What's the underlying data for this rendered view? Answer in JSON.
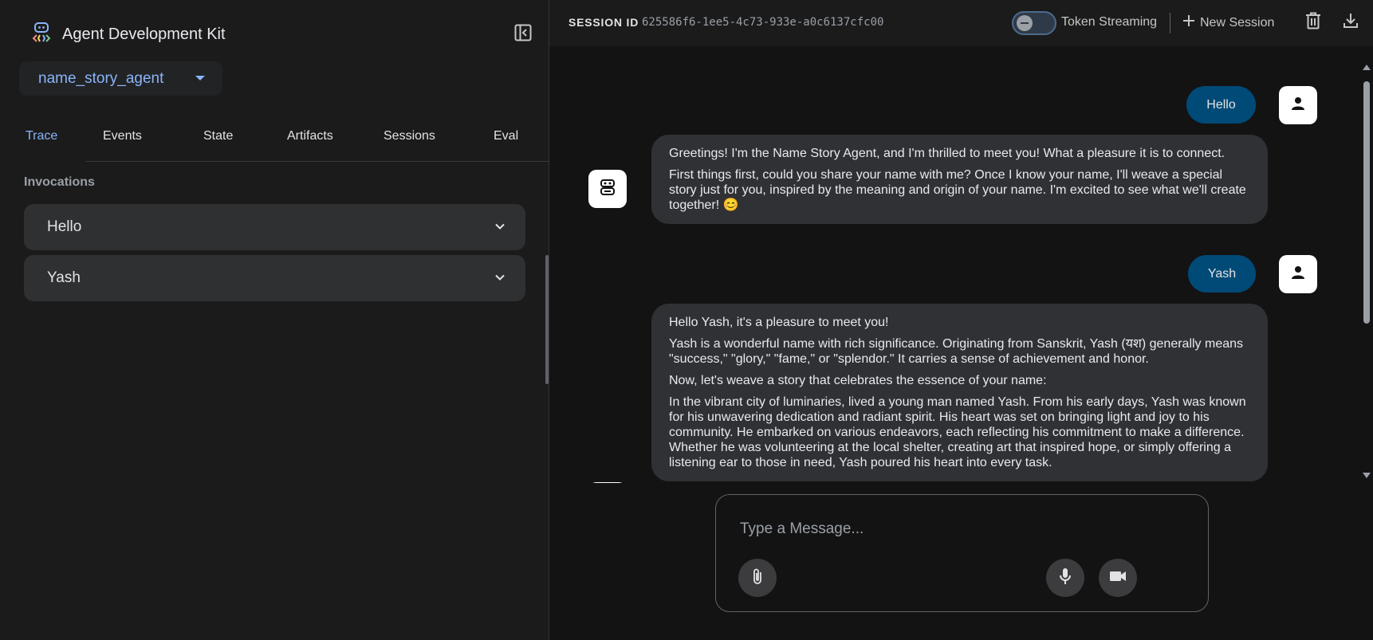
{
  "sidebar": {
    "brand_title": "Agent Development Kit",
    "agent_selector": {
      "selected": "name_story_agent"
    },
    "tabs": [
      {
        "label": "Trace",
        "active": true
      },
      {
        "label": "Events",
        "active": false
      },
      {
        "label": "State",
        "active": false
      },
      {
        "label": "Artifacts",
        "active": false
      },
      {
        "label": "Sessions",
        "active": false
      },
      {
        "label": "Eval",
        "active": false
      }
    ],
    "invocations_heading": "Invocations",
    "invocations": [
      {
        "label": "Hello"
      },
      {
        "label": "Yash"
      }
    ]
  },
  "topbar": {
    "session_label": "SESSION ID",
    "session_id": "625586f6-1ee5-4c73-933e-a0c6137cfc00",
    "token_streaming_label": "Token Streaming",
    "token_streaming_enabled": false,
    "new_session_label": "New Session"
  },
  "chat": {
    "messages": [
      {
        "role": "user",
        "text": "Hello"
      },
      {
        "role": "agent",
        "paragraphs": [
          "Greetings! I'm the Name Story Agent, and I'm thrilled to meet you! What a pleasure it is to connect.",
          "First things first, could you share your name with me? Once I know your name, I'll weave a special story just for you, inspired by the meaning and origin of your name. I'm excited to see what we'll create together! 😊"
        ]
      },
      {
        "role": "user",
        "text": "Yash"
      },
      {
        "role": "agent",
        "paragraphs": [
          "Hello Yash, it's a pleasure to meet you!",
          "Yash is a wonderful name with rich significance. Originating from Sanskrit, Yash (यश) generally means \"success,\" \"glory,\" \"fame,\" or \"splendor.\" It carries a sense of achievement and honor.",
          "Now, let's weave a story that celebrates the essence of your name:",
          "In the vibrant city of luminaries, lived a young man named Yash. From his early days, Yash was known for his unwavering dedication and radiant spirit. His heart was set on bringing light and joy to his community. He embarked on various endeavors, each reflecting his commitment to make a difference. Whether he was volunteering at the local shelter, creating art that inspired hope, or simply offering a listening ear to those in need, Yash poured his heart into every task."
        ]
      }
    ]
  },
  "composer": {
    "placeholder": "Type a Message..."
  },
  "colors": {
    "accent": "#8ab4f8",
    "user_bubble": "#004a77",
    "agent_bubble": "#303134",
    "background": "#131314"
  }
}
